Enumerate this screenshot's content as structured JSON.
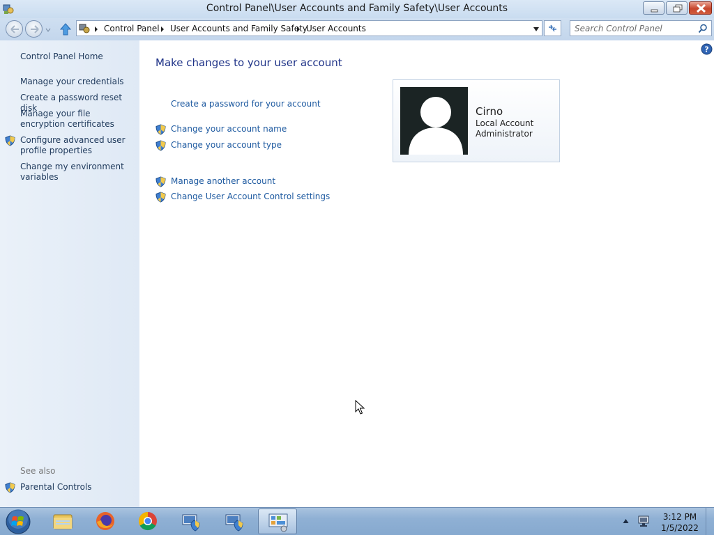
{
  "window": {
    "title": "Control Panel\\User Accounts and Family Safety\\User Accounts",
    "title_icon": "control-panel-icon"
  },
  "address_bar": {
    "breadcrumbs": [
      "Control Panel",
      "User Accounts and Family Safety",
      "User Accounts"
    ]
  },
  "search": {
    "placeholder": "Search Control Panel"
  },
  "sidebar": {
    "home": "Control Panel Home",
    "items": [
      {
        "label": "Manage your credentials",
        "shield": false
      },
      {
        "label": "Create a password reset disk",
        "shield": false
      },
      {
        "label": "Manage your file encryption certificates",
        "shield": false
      },
      {
        "label": "Configure advanced user profile properties",
        "shield": true
      },
      {
        "label": "Change my environment variables",
        "shield": false
      }
    ],
    "see_also_label": "See also",
    "see_also": [
      {
        "label": "Parental Controls",
        "shield": true
      }
    ]
  },
  "main": {
    "heading": "Make changes to your user account",
    "tasks_group1": [
      {
        "label": "Create a password for your account",
        "shield": false
      },
      {
        "label": "Change your account name",
        "shield": true
      },
      {
        "label": "Change your account type",
        "shield": true
      }
    ],
    "tasks_group2": [
      {
        "label": "Manage another account",
        "shield": true
      },
      {
        "label": "Change User Account Control settings",
        "shield": true
      }
    ]
  },
  "account": {
    "name": "Cirno",
    "type": "Local Account",
    "role": "Administrator"
  },
  "taskbar": {
    "pinned": [
      "windows-explorer-icon",
      "firefox-icon",
      "chrome-icon",
      "network-setup-icon",
      "network-setup-icon",
      "control-panel-icon"
    ],
    "active_index": 5,
    "clock_time": "3:12 PM",
    "clock_date": "1/5/2022"
  },
  "colors": {
    "link": "#1e5aa0",
    "heading": "#1e3287",
    "sidebar_link": "#1e395b"
  }
}
